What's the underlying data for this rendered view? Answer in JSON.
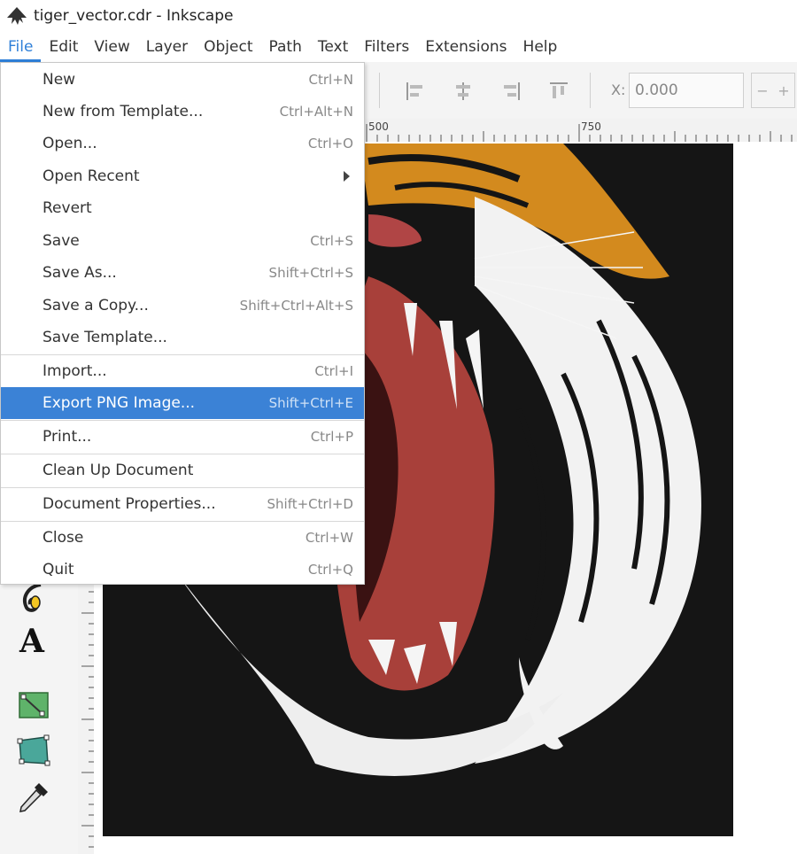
{
  "window": {
    "title": "tiger_vector.cdr - Inkscape"
  },
  "menubar": {
    "items": [
      "File",
      "Edit",
      "View",
      "Layer",
      "Object",
      "Path",
      "Text",
      "Filters",
      "Extensions",
      "Help"
    ]
  },
  "file_menu": {
    "items": [
      {
        "label": "New",
        "shortcut": "Ctrl+N"
      },
      {
        "label": "New from Template...",
        "shortcut": "Ctrl+Alt+N"
      },
      {
        "label": "Open...",
        "shortcut": "Ctrl+O"
      },
      {
        "label": "Open Recent",
        "shortcut": ""
      },
      {
        "label": "Revert",
        "shortcut": ""
      },
      {
        "label": "Save",
        "shortcut": "Ctrl+S"
      },
      {
        "label": "Save As...",
        "shortcut": "Shift+Ctrl+S"
      },
      {
        "label": "Save a Copy...",
        "shortcut": "Shift+Ctrl+Alt+S"
      },
      {
        "label": "Save Template...",
        "shortcut": ""
      },
      {
        "label": "Import...",
        "shortcut": "Ctrl+I"
      },
      {
        "label": "Export PNG Image...",
        "shortcut": "Shift+Ctrl+E"
      },
      {
        "label": "Print...",
        "shortcut": "Ctrl+P"
      },
      {
        "label": "Clean Up Document",
        "shortcut": ""
      },
      {
        "label": "Document Properties...",
        "shortcut": "Shift+Ctrl+D"
      },
      {
        "label": "Close",
        "shortcut": "Ctrl+W"
      },
      {
        "label": "Quit",
        "shortcut": "Ctrl+Q"
      }
    ],
    "highlighted": "Export PNG Image..."
  },
  "toolbar": {
    "x_label": "X:",
    "x_value": "0.000",
    "spin_minus": "−",
    "spin_plus": "+"
  },
  "ruler": {
    "top_labels": [
      "500",
      "750"
    ]
  },
  "colors": {
    "accent": "#3b82d6",
    "canvas_bg": "#151515",
    "tiger_orange": "#d38a1e",
    "mouth_red": "#a8403a"
  }
}
